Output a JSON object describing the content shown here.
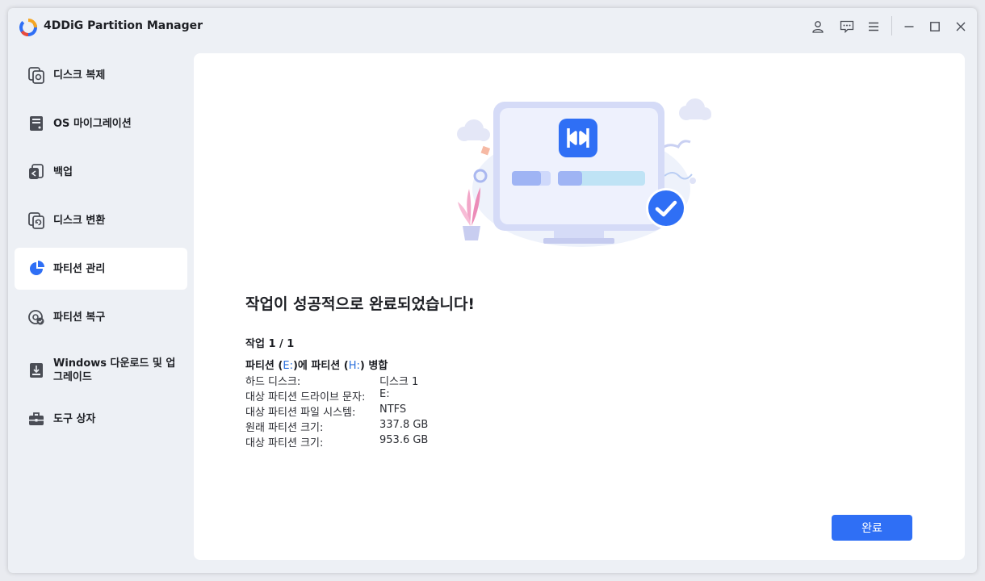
{
  "app": {
    "title": "4DDiG Partition Manager"
  },
  "titlebar": {
    "icons": [
      "user-icon",
      "feedback-icon",
      "menu-icon",
      "minimize-icon",
      "maximize-icon",
      "close-icon"
    ]
  },
  "sidebar": {
    "items": [
      {
        "label": "디스크 복제",
        "icon": "disk-clone-icon"
      },
      {
        "label": "OS 마이그레이션",
        "icon": "os-migration-icon"
      },
      {
        "label": "백업",
        "icon": "backup-icon"
      },
      {
        "label": "디스크 변환",
        "icon": "disk-convert-icon"
      },
      {
        "label": "파티션 관리",
        "icon": "partition-pie-icon",
        "active": true
      },
      {
        "label": "파티션 복구",
        "icon": "partition-recovery-icon"
      },
      {
        "label": "Windows 다운로드 및 업그레이드",
        "icon": "windows-download-icon"
      },
      {
        "label": "도구 상자",
        "icon": "toolbox-icon"
      }
    ]
  },
  "main": {
    "heading": "작업이 성공적으로 완료되었습니다!",
    "task_count": "작업 1 / 1",
    "operation": {
      "prefix": "파티션 (",
      "drive_a": "E:",
      "middle": ")에 파티션 (",
      "drive_b": "H:",
      "suffix": ") 병합"
    },
    "details": [
      {
        "key": "하드 디스크:",
        "value": "디스크 1"
      },
      {
        "key": "대상 파티션 드라이브 문자:",
        "value": "E:"
      },
      {
        "key": "대상 파티션 파일 시스템:",
        "value": "NTFS"
      },
      {
        "key": "원래 파티션 크기:",
        "value": "337.8 GB"
      },
      {
        "key": "대상 파티션 크기:",
        "value": "953.6 GB"
      }
    ],
    "done_button": "완료"
  },
  "colors": {
    "accent": "#2f6ff5",
    "drive_letter": "#2a6fdb",
    "background": "#edf0f5",
    "panel": "#ffffff"
  }
}
